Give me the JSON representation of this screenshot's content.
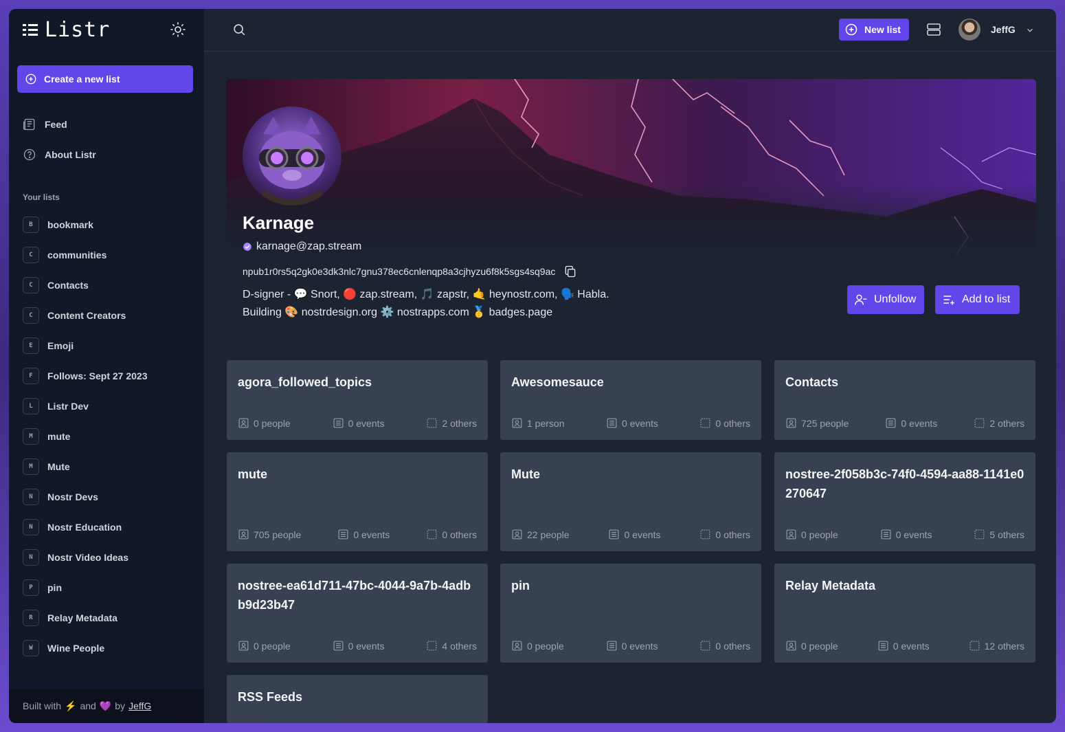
{
  "app": {
    "name": "Listr"
  },
  "sidebar": {
    "create_label": "Create a new list",
    "nav": [
      {
        "label": "Feed",
        "icon": "feed-icon"
      },
      {
        "label": "About Listr",
        "icon": "question-circle-icon"
      }
    ],
    "section_title": "Your lists",
    "lists": [
      {
        "initial": "B",
        "label": "bookmark"
      },
      {
        "initial": "C",
        "label": "communities"
      },
      {
        "initial": "C",
        "label": "Contacts"
      },
      {
        "initial": "C",
        "label": "Content Creators"
      },
      {
        "initial": "E",
        "label": "Emoji"
      },
      {
        "initial": "F",
        "label": "Follows: Sept 27 2023"
      },
      {
        "initial": "L",
        "label": "Listr Dev"
      },
      {
        "initial": "M",
        "label": "mute"
      },
      {
        "initial": "M",
        "label": "Mute"
      },
      {
        "initial": "N",
        "label": "Nostr Devs"
      },
      {
        "initial": "N",
        "label": "Nostr Education"
      },
      {
        "initial": "N",
        "label": "Nostr Video Ideas"
      },
      {
        "initial": "P",
        "label": "pin"
      },
      {
        "initial": "R",
        "label": "Relay Metadata"
      },
      {
        "initial": "W",
        "label": "Wine People"
      }
    ],
    "footer": {
      "built_with": "Built with",
      "bolt": "⚡",
      "and": "and",
      "heart": "💜",
      "by": "by",
      "author": "JeffG"
    }
  },
  "topbar": {
    "new_list_label": "New list",
    "user_name": "JeffG"
  },
  "profile": {
    "name": "Karnage",
    "nip05": "karnage@zap.stream",
    "npub": "npub1r0rs5q2gk0e3dk3nlc7gnu378ec6cnlenqp8a3cjhyzu6f8k5sgs4sq9ac",
    "about": "D-signer - 💬 Snort, 🔴 zap.stream, 🎵 zapstr, 🤙 heynostr.com, 🗣️ Habla.\nBuilding 🎨 nostrdesign.org ⚙️ nostrapps.com 🥇 badges.page",
    "unfollow_label": "Unfollow",
    "add_to_list_label": "Add to list"
  },
  "lists": [
    {
      "title": "agora_followed_topics",
      "people": "0 people",
      "events": "0 events",
      "others": "2 others"
    },
    {
      "title": "Awesomesauce",
      "people": "1 person",
      "events": "0 events",
      "others": "0 others"
    },
    {
      "title": "Contacts",
      "people": "725 people",
      "events": "0 events",
      "others": "2 others"
    },
    {
      "title": "mute",
      "people": "705 people",
      "events": "0 events",
      "others": "0 others"
    },
    {
      "title": "Mute",
      "people": "22 people",
      "events": "0 events",
      "others": "0 others"
    },
    {
      "title": "nostree-2f058b3c-74f0-4594-aa88-1141e0270647",
      "people": "0 people",
      "events": "0 events",
      "others": "5 others"
    },
    {
      "title": "nostree-ea61d711-47bc-4044-9a7b-4adbb9d23b47",
      "people": "0 people",
      "events": "0 events",
      "others": "4 others"
    },
    {
      "title": "pin",
      "people": "0 people",
      "events": "0 events",
      "others": "0 others"
    },
    {
      "title": "Relay Metadata",
      "people": "0 people",
      "events": "0 events",
      "others": "12 others"
    },
    {
      "title": "RSS Feeds",
      "people": "",
      "events": "",
      "others": ""
    }
  ],
  "colors": {
    "accent": "#6246ea",
    "sidebar": "#111827",
    "main": "#1c2331",
    "card": "#374151"
  }
}
